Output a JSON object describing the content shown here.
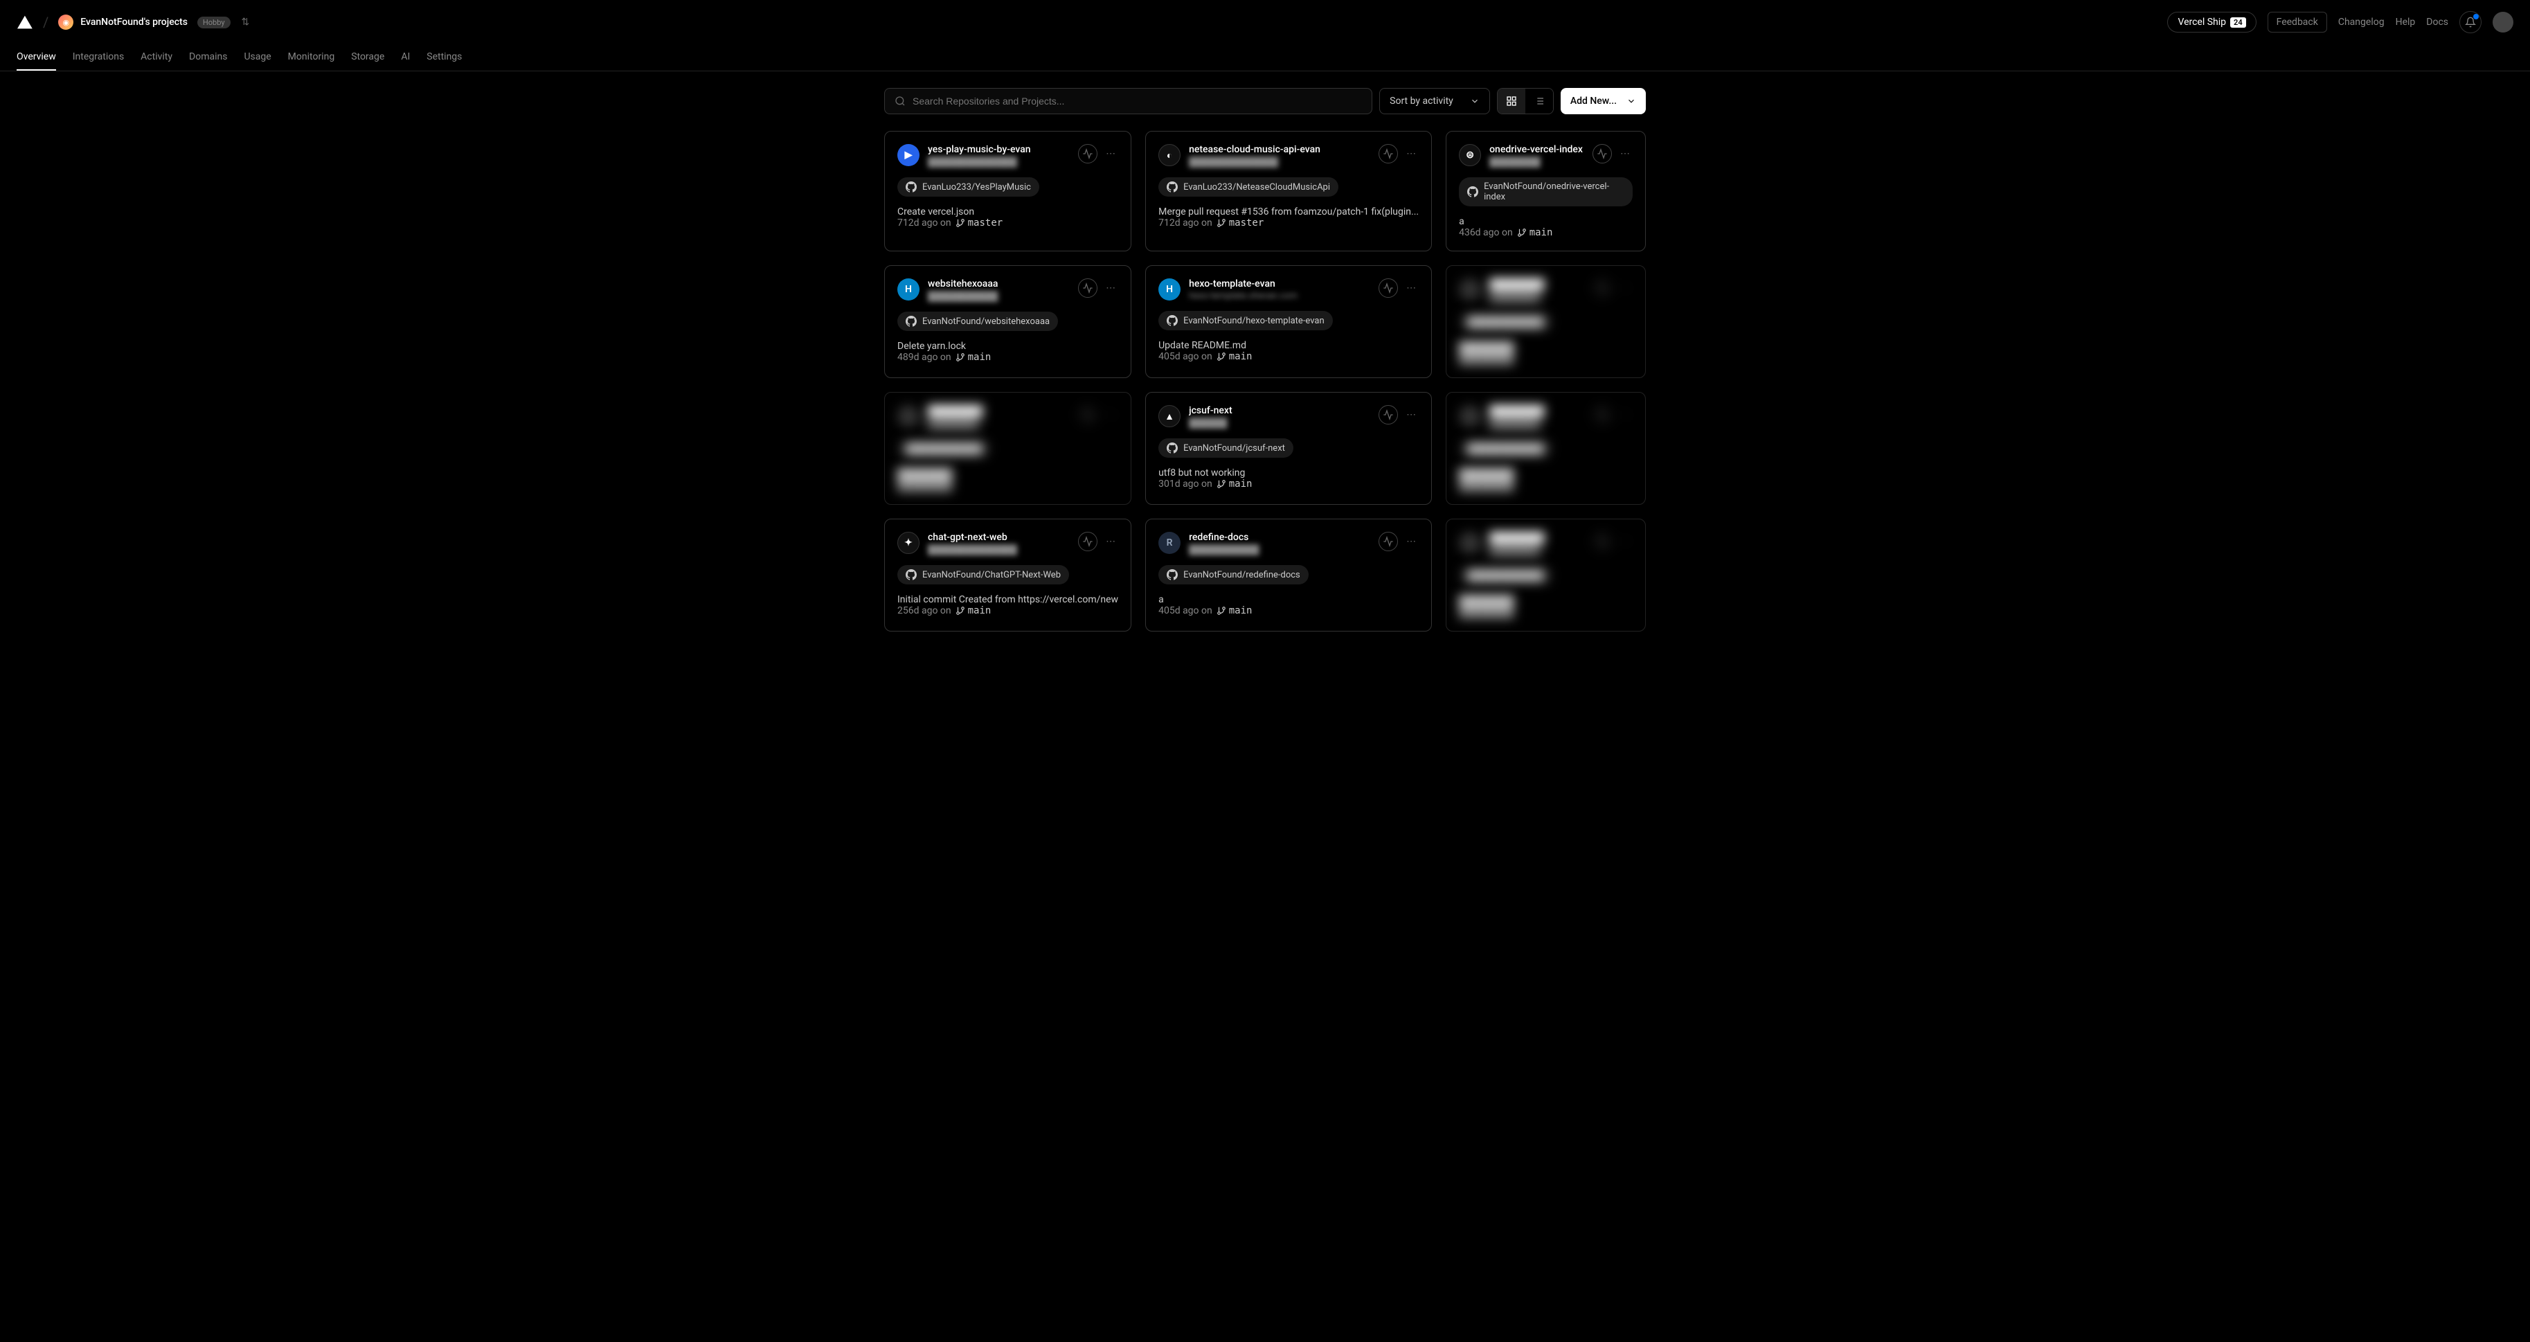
{
  "header": {
    "team_name": "EvanNotFound's projects",
    "plan_badge": "Hobby",
    "ship_label": "Vercel Ship",
    "ship_badge": "24",
    "feedback": "Feedback",
    "links": {
      "changelog": "Changelog",
      "help": "Help",
      "docs": "Docs"
    }
  },
  "tabs": [
    "Overview",
    "Integrations",
    "Activity",
    "Domains",
    "Usage",
    "Monitoring",
    "Storage",
    "AI",
    "Settings"
  ],
  "controls": {
    "search_placeholder": "Search Repositories and Projects...",
    "sort_label": "Sort by activity",
    "add_new": "Add New..."
  },
  "projects": [
    {
      "name": "yes-play-music-by-evan",
      "url": "██████████████",
      "repo": "EvanLuo233/YesPlayMusic",
      "commit": "Create vercel.json",
      "age": "712d ago on",
      "branch": "master",
      "icon_class": "icon-blue",
      "icon_text": "▶"
    },
    {
      "name": "netease-cloud-music-api-evan",
      "url": "██████████████",
      "repo": "EvanLuo233/NeteaseCloudMusicApi",
      "commit": "Merge pull request #1536 from foamzou/patch-1 fix(plugin...",
      "age": "712d ago on",
      "branch": "master",
      "icon_class": "icon-dark",
      "icon_text": "◐"
    },
    {
      "name": "onedrive-vercel-index",
      "url": "████████",
      "repo": "EvanNotFound/onedrive-vercel-index",
      "commit": "a",
      "age": "436d ago on",
      "branch": "main",
      "icon_class": "icon-dark",
      "icon_text": "⊜"
    },
    {
      "name": "websitehexoaaa",
      "url": "███████████",
      "repo": "EvanNotFound/websitehexoaaa",
      "commit": "Delete yarn.lock",
      "age": "489d ago on",
      "branch": "main",
      "icon_class": "icon-h",
      "icon_text": "H"
    },
    {
      "name": "hexo-template-evan",
      "url": "hexo-template.ohevan.com",
      "repo": "EvanNotFound/hexo-template-evan",
      "commit": "Update README.md",
      "age": "405d ago on",
      "branch": "main",
      "icon_class": "icon-h",
      "icon_text": "H"
    },
    {
      "blurred": true
    },
    {
      "blurred": true
    },
    {
      "name": "jcsuf-next",
      "url": "██████",
      "repo": "EvanNotFound/jcsuf-next",
      "commit": "utf8 but not working",
      "age": "301d ago on",
      "branch": "main",
      "icon_class": "icon-dark",
      "icon_text": "▲"
    },
    {
      "blurred": true
    },
    {
      "name": "chat-gpt-next-web",
      "url": "██████████████",
      "repo": "EvanNotFound/ChatGPT-Next-Web",
      "commit": "Initial commit Created from https://vercel.com/new",
      "age": "256d ago on",
      "branch": "main",
      "icon_class": "icon-dark",
      "icon_text": "✦"
    },
    {
      "name": "redefine-docs",
      "url": "███████████",
      "repo": "EvanNotFound/redefine-docs",
      "commit": "a",
      "age": "405d ago on",
      "branch": "main",
      "icon_class": "icon-r",
      "icon_text": "R"
    },
    {
      "blurred": true
    }
  ]
}
